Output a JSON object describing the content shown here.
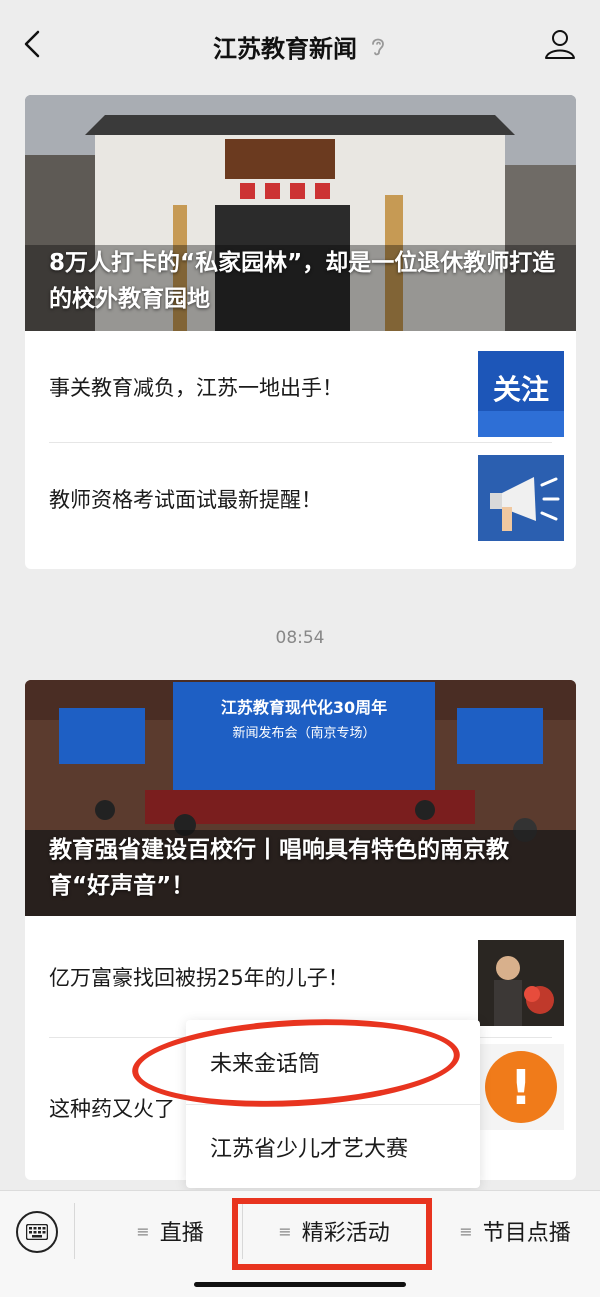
{
  "header": {
    "title": "江苏教育新闻",
    "back_icon": "chevron-left-icon",
    "ear_icon": "ear-icon",
    "profile_icon": "person-icon"
  },
  "article_groups": [
    {
      "hero_title": "8万人打卡的“私家园林”，却是一位退休教师打造的校外教育园地",
      "items": [
        {
          "text": "事关教育减负，江苏一地出手！",
          "thumb_text": "关注"
        },
        {
          "text": "教师资格考试面试最新提醒！",
          "thumb_text": ""
        }
      ]
    },
    {
      "hero_title": "教育强省建设百校行丨唱响具有特色的南京教育“好声音”！",
      "hero_banner": [
        "江苏教育现代化30周年",
        "新闻发布会（南京专场）"
      ],
      "items": [
        {
          "text": "亿万富豪找回被拐25年的儿子！",
          "thumb_text": ""
        },
        {
          "text": "这种药又火了",
          "thumb_text": "!"
        }
      ]
    }
  ],
  "time_separator": "08:54",
  "popup_menu": [
    "未来金话筒",
    "江苏省少儿才艺大赛"
  ],
  "bottom_menu": {
    "keyboard_icon": "keyboard-icon",
    "items": [
      "直播",
      "精彩活动",
      "节目点播"
    ]
  },
  "colors": {
    "highlight": "#e8341f",
    "background": "#ededed"
  }
}
